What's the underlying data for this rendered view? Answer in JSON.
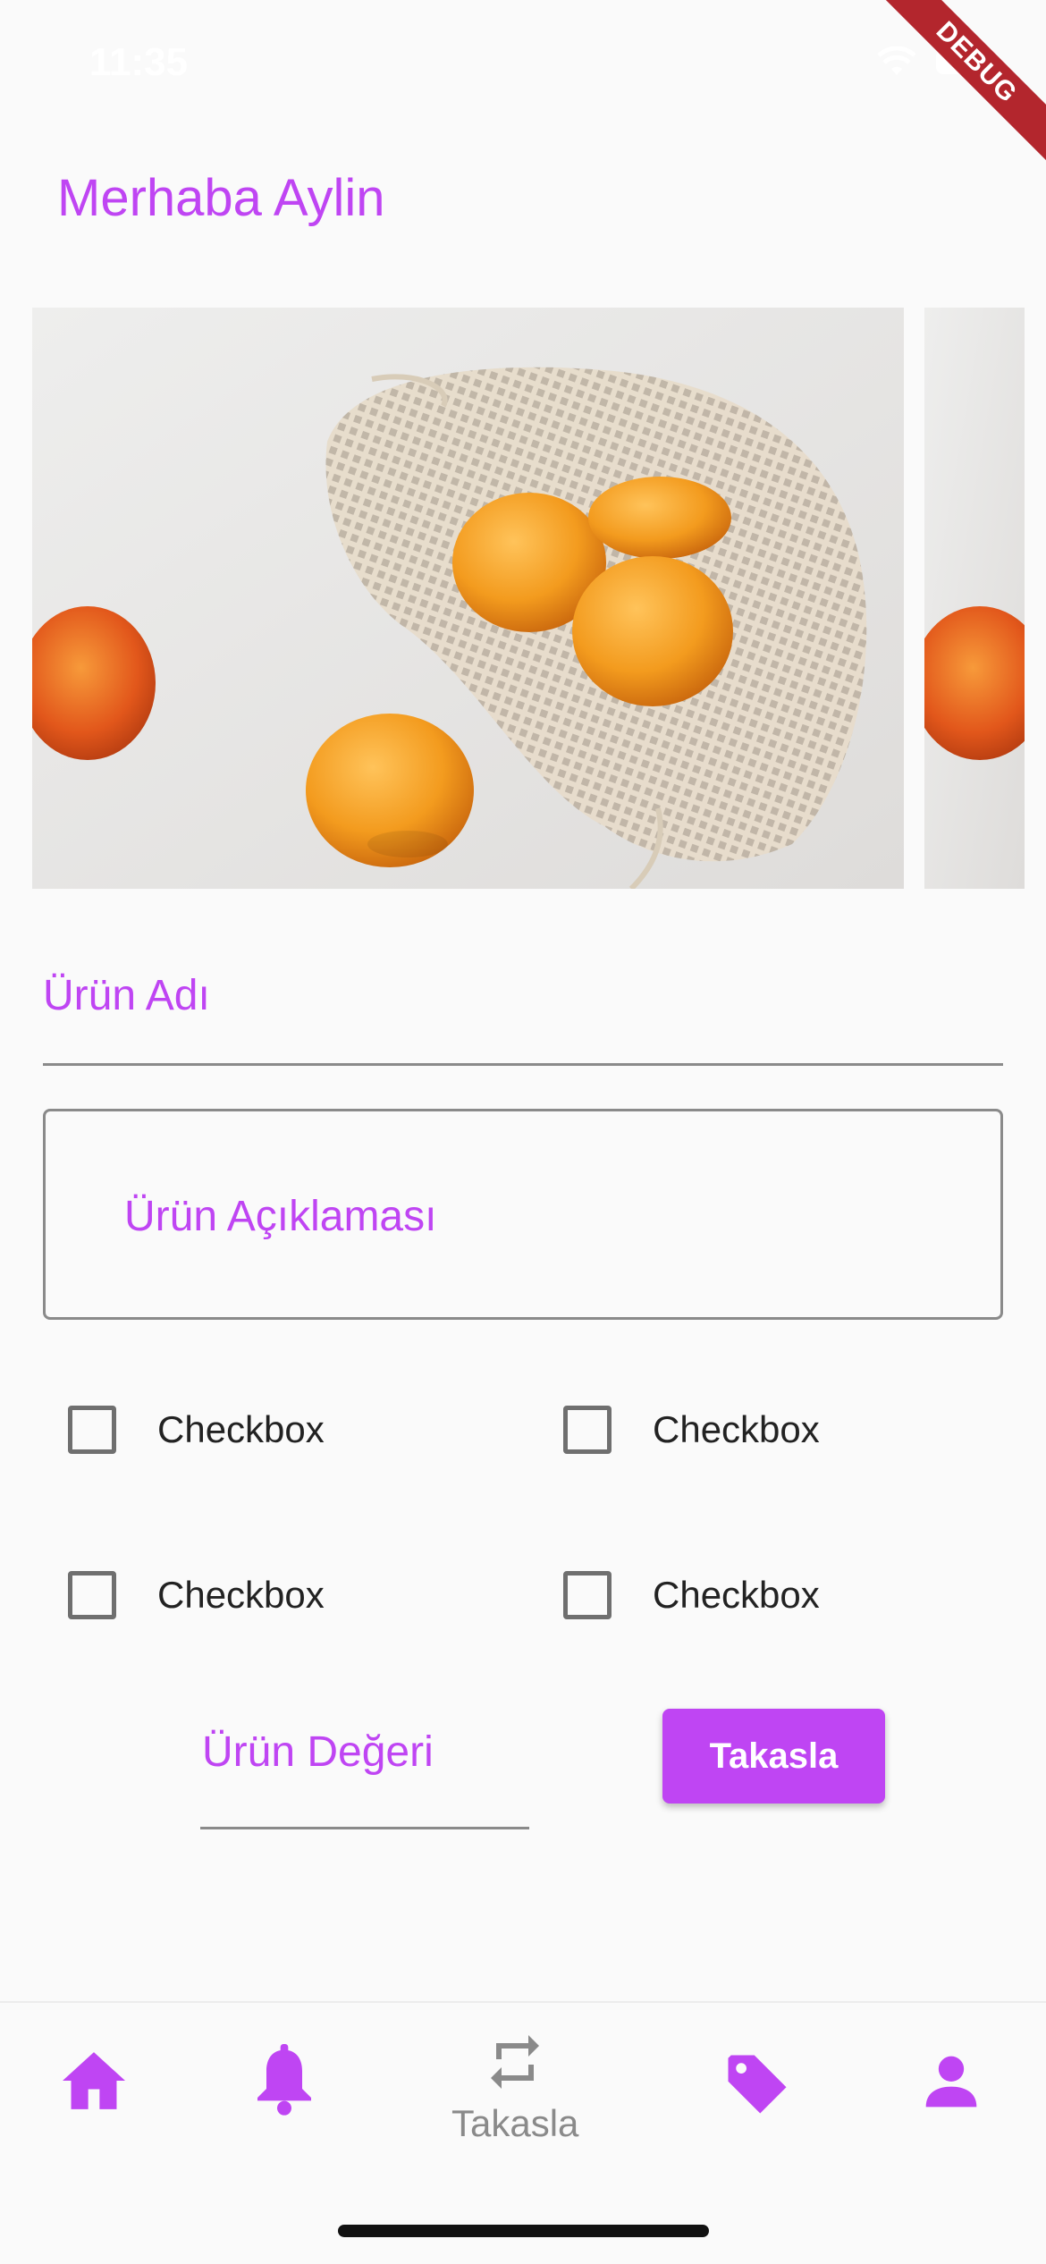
{
  "status_bar": {
    "time": "11:35"
  },
  "debug_banner": "DEBUG",
  "greeting": "Merhaba Aylin",
  "form": {
    "name_placeholder": "Ürün Adı",
    "description_placeholder": "Ürün Açıklaması",
    "value_placeholder": "Ürün Değeri",
    "submit_label": "Takasla"
  },
  "checkboxes": [
    {
      "label": "Checkbox",
      "checked": false
    },
    {
      "label": "Checkbox",
      "checked": false
    },
    {
      "label": "Checkbox",
      "checked": false
    },
    {
      "label": "Checkbox",
      "checked": false
    }
  ],
  "bottom_nav": {
    "items": [
      {
        "icon": "home-icon",
        "label": ""
      },
      {
        "icon": "bell-icon",
        "label": ""
      },
      {
        "icon": "swap-icon",
        "label": "Takasla"
      },
      {
        "icon": "tag-icon",
        "label": ""
      },
      {
        "icon": "person-icon",
        "label": ""
      }
    ]
  },
  "colors": {
    "accent": "#bf45f3",
    "inactive": "#8a8a8a",
    "background": "#fafafa"
  }
}
